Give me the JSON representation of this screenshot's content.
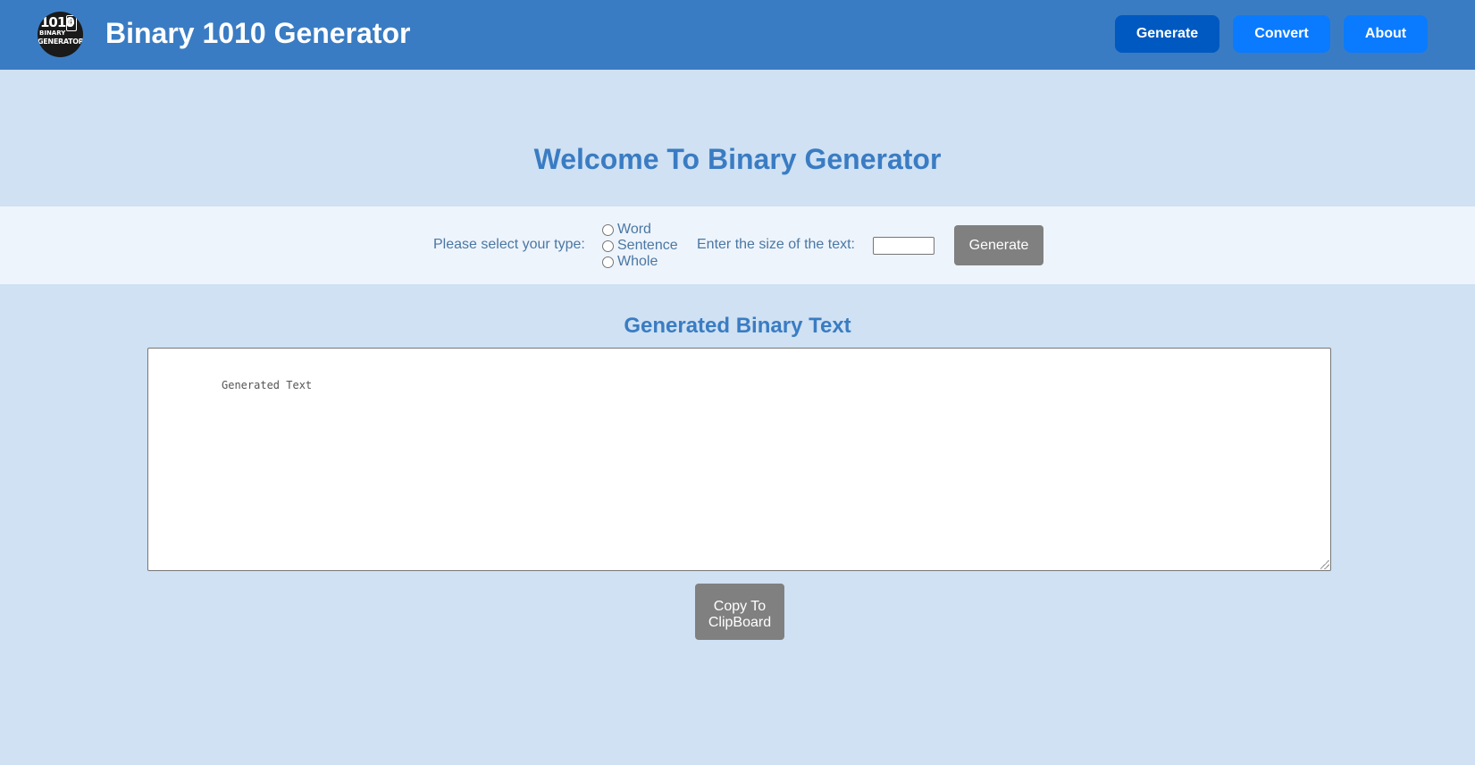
{
  "header": {
    "logo": {
      "icon": "binary-generator-logo-icon",
      "line1": "1010",
      "box_char": "1 0",
      "line2": "BINARY",
      "line3": "GENERATOR"
    },
    "title": "Binary 1010 Generator",
    "nav": [
      {
        "label": "Generate",
        "active": true
      },
      {
        "label": "Convert",
        "active": false
      },
      {
        "label": "About",
        "active": false
      }
    ]
  },
  "main": {
    "welcome_heading": "Welcome To Binary Generator",
    "type_label": "Please select your type:",
    "type_options": [
      "Word",
      "Sentence",
      "Whole"
    ],
    "size_label": "Enter the size of the text:",
    "size_value": "",
    "generate_button": "Generate",
    "output_heading": "Generated Binary Text",
    "output_text": "Generated Text",
    "copy_button_line1": "Copy To",
    "copy_button_line2": "ClipBoard"
  },
  "colors": {
    "header_bg": "#3a7cc3",
    "page_bg": "#cfe1f3",
    "band_bg": "#eef4fc",
    "nav_button": "#0a7bff",
    "nav_button_active": "#0059c1",
    "heading_text": "#3a7cc3",
    "gray_button": "#808080"
  }
}
